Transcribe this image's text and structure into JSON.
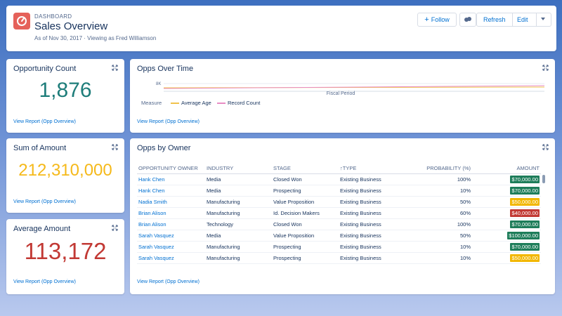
{
  "header": {
    "kicker": "DASHBOARD",
    "title": "Sales Overview",
    "subtitle": "As of Nov 30, 2017 · Viewing as Fred Williamson",
    "follow_label": "Follow",
    "refresh_label": "Refresh",
    "edit_label": "Edit"
  },
  "widgets": {
    "count": {
      "title": "Opportunity Count",
      "value": "1,876",
      "link": "View Report (Opp Overview)"
    },
    "sum": {
      "title": "Sum of Amount",
      "value": "212,310,000",
      "link": "View Report (Opp Overview)"
    },
    "avg": {
      "title": "Average Amount",
      "value": "113,172",
      "link": "View Report (Opp Overview)"
    },
    "time": {
      "title": "Opps Over Time",
      "tick": "8K",
      "xlabel": "Fiscal Period",
      "legend_label": "Measure",
      "series": [
        {
          "name": "Average Age",
          "color": "#f0c24b"
        },
        {
          "name": "Record Count",
          "color": "#e88cc4"
        }
      ],
      "link": "View Report (Opp Overview)"
    },
    "owner": {
      "title": "Opps by Owner",
      "link": "View Report (Opp Overview)",
      "columns": [
        "OPPORTUNITY OWNER",
        "INDUSTRY",
        "STAGE",
        "↑TYPE",
        "PROBABILITY (%)",
        "AMOUNT"
      ],
      "rows": [
        {
          "owner": "Hank Chen",
          "industry": "Media",
          "stage": "Closed Won",
          "type": "Existing Business",
          "prob": "100%",
          "amount": "$70,000.00",
          "color": "#1e7d5a"
        },
        {
          "owner": "Hank Chen",
          "industry": "Media",
          "stage": "Prospecting",
          "type": "Existing Business",
          "prob": "10%",
          "amount": "$70,000.00",
          "color": "#1e7d5a"
        },
        {
          "owner": "Nadia Smith",
          "industry": "Manufacturing",
          "stage": "Value Proposition",
          "type": "Existing Business",
          "prob": "50%",
          "amount": "$50,000.00",
          "color": "#f2b700"
        },
        {
          "owner": "Brian Alison",
          "industry": "Manufacturing",
          "stage": "Id. Decision Makers",
          "type": "Existing Business",
          "prob": "60%",
          "amount": "$40,000.00",
          "color": "#c23934"
        },
        {
          "owner": "Brian Alison",
          "industry": "Technology",
          "stage": "Closed Won",
          "type": "Existing Business",
          "prob": "100%",
          "amount": "$70,000.00",
          "color": "#1e7d5a"
        },
        {
          "owner": "Sarah Vasquez",
          "industry": "Media",
          "stage": "Value Proposition",
          "type": "Existing Business",
          "prob": "50%",
          "amount": "$100,000.00",
          "color": "#1e7d5a"
        },
        {
          "owner": "Sarah Vasquez",
          "industry": "Manufacturing",
          "stage": "Prospecting",
          "type": "Existing Business",
          "prob": "10%",
          "amount": "$70,000.00",
          "color": "#1e7d5a"
        },
        {
          "owner": "Sarah Vasquez",
          "industry": "Manufacturing",
          "stage": "Prospecting",
          "type": "Existing Business",
          "prob": "10%",
          "amount": "$50,000.00",
          "color": "#f2b700"
        }
      ]
    }
  },
  "colors": {
    "count_value": "#1e7d7a",
    "sum_value": "#f5b91a",
    "avg_value": "#c23934"
  }
}
